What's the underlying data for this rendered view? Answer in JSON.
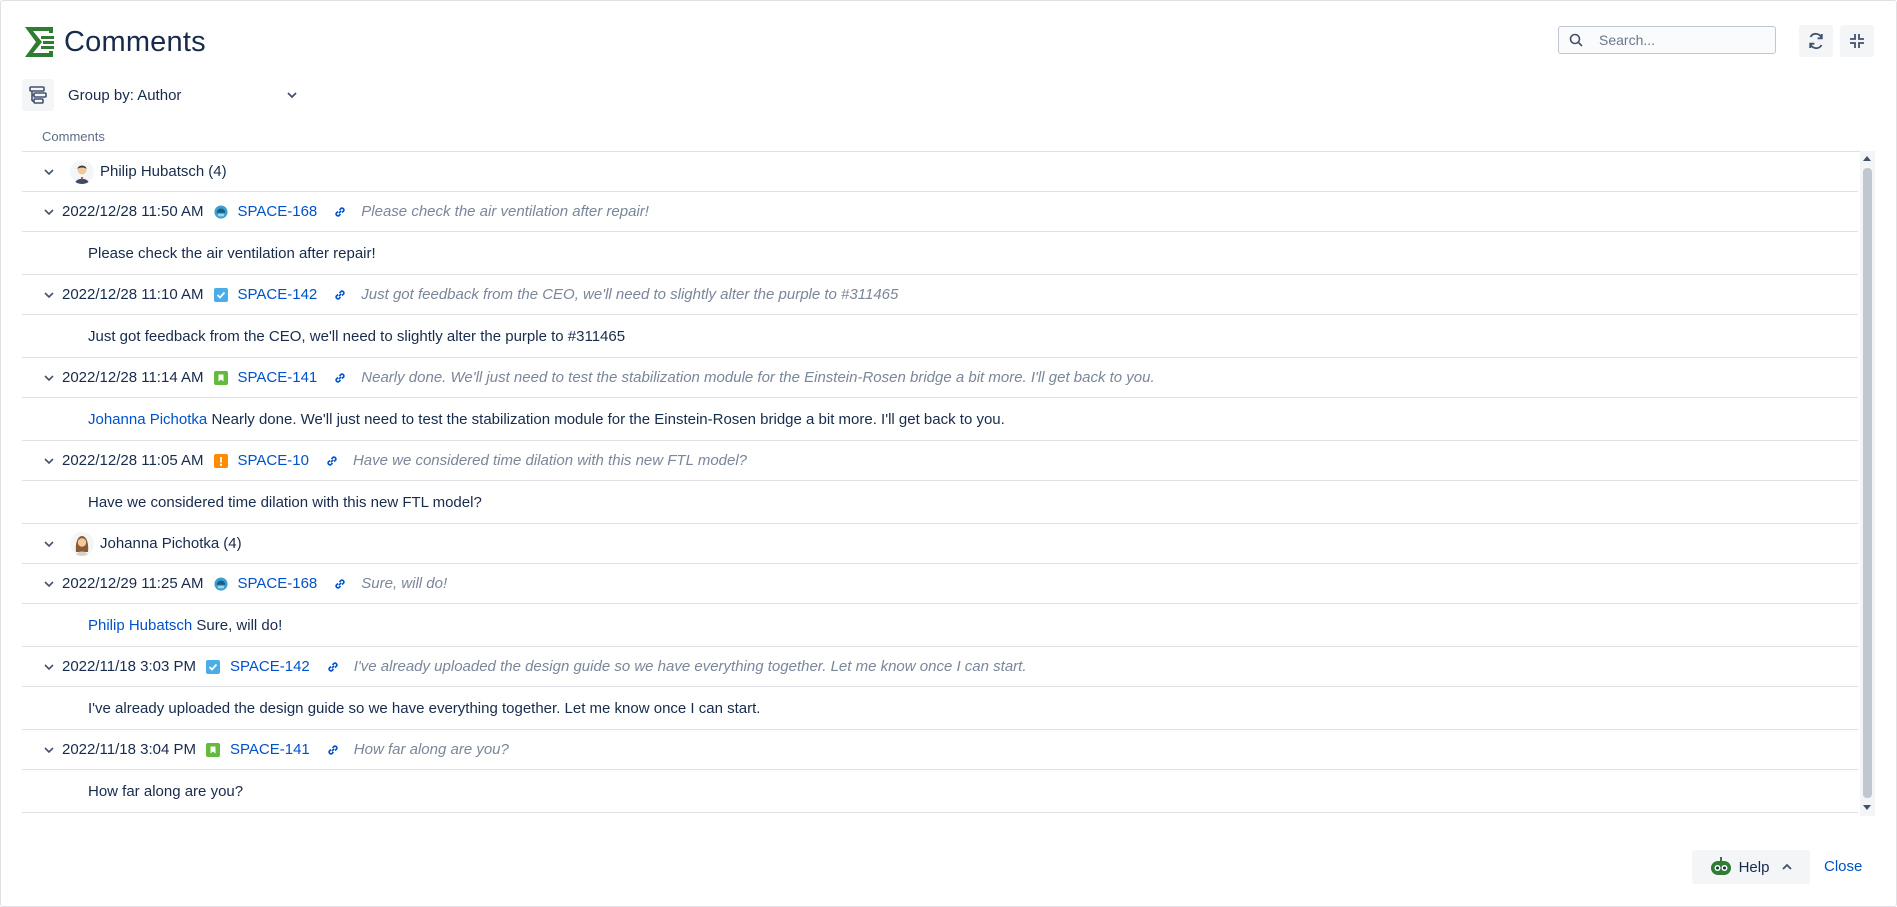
{
  "header": {
    "title": "Comments"
  },
  "search": {
    "placeholder": "Search..."
  },
  "toolbar": {
    "group_label": "Group by: Author"
  },
  "table": {
    "column_header": "Comments"
  },
  "rows": [
    {
      "kind": "author",
      "name": "Philip Hubatsch",
      "count": "(4)"
    },
    {
      "kind": "meta",
      "date": "2022/12/28 11:50 AM",
      "issue_type": "task-round",
      "issue": "SPACE-168",
      "preview": "Please check the air ventilation after repair!"
    },
    {
      "kind": "body",
      "mention": "",
      "text": "Please check the air ventilation after repair!"
    },
    {
      "kind": "meta",
      "date": "2022/12/28 11:10 AM",
      "issue_type": "checkbox",
      "issue": "SPACE-142",
      "preview": "Just got feedback from the CEO, we'll need to slightly alter the purple to #311465"
    },
    {
      "kind": "body",
      "mention": "",
      "text": "Just got feedback from the CEO, we'll need to slightly alter the purple to #311465"
    },
    {
      "kind": "meta",
      "date": "2022/12/28 11:14 AM",
      "issue_type": "story",
      "issue": "SPACE-141",
      "preview": "Nearly done. We'll just need to test the stabilization module for the Einstein-Rosen bridge a bit more. I'll get back to you."
    },
    {
      "kind": "body",
      "mention": "Johanna Pichotka",
      "text": "Nearly done. We'll just need to test the stabilization module for the Einstein-Rosen bridge a bit more. I'll get back to you."
    },
    {
      "kind": "meta",
      "date": "2022/12/28 11:05 AM",
      "issue_type": "alert",
      "issue": "SPACE-10",
      "preview": "Have we considered time dilation with this new FTL model?"
    },
    {
      "kind": "body",
      "mention": "",
      "text": "Have we considered time dilation with this new FTL model?"
    },
    {
      "kind": "author",
      "name": "Johanna Pichotka",
      "count": "(4)"
    },
    {
      "kind": "meta",
      "date": "2022/12/29 11:25 AM",
      "issue_type": "task-round",
      "issue": "SPACE-168",
      "preview": "Sure, will do!"
    },
    {
      "kind": "body",
      "mention": "Philip Hubatsch",
      "text": "Sure, will do!"
    },
    {
      "kind": "meta",
      "date": "2022/11/18 3:03 PM",
      "issue_type": "checkbox",
      "issue": "SPACE-142",
      "preview": "I've already uploaded the design guide so we have everything together. Let me know once I can start."
    },
    {
      "kind": "body",
      "mention": "",
      "text": "I've already uploaded the design guide so we have everything together. Let me know once I can start."
    },
    {
      "kind": "meta",
      "date": "2022/11/18 3:04 PM",
      "issue_type": "story",
      "issue": "SPACE-141",
      "preview": "How far along are you?"
    },
    {
      "kind": "body",
      "mention": "",
      "text": "How far along are you?"
    }
  ],
  "footer": {
    "help_label": "Help",
    "close_label": "Close"
  },
  "colors": {
    "brand_green": "#2e7d32",
    "link_blue": "#0052cc",
    "checkbox_blue": "#4bade8",
    "story_green": "#63ba3c",
    "alert_orange": "#ff8b00",
    "round_blue": "#3aa0d0"
  }
}
